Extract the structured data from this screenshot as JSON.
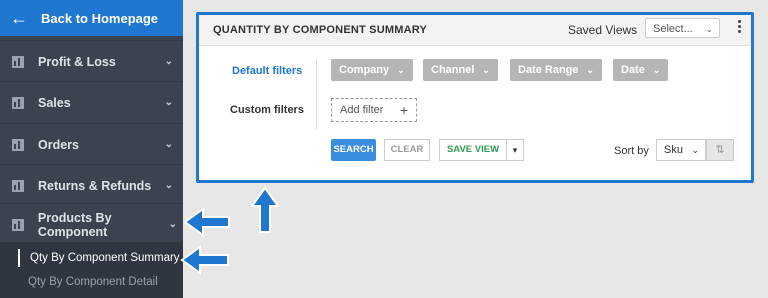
{
  "sidebar": {
    "back_label": "Back to Homepage",
    "items": [
      {
        "label": "Profit & Loss"
      },
      {
        "label": "Sales"
      },
      {
        "label": "Orders"
      },
      {
        "label": "Returns & Refunds"
      },
      {
        "label": "Products By Component"
      }
    ],
    "sub_items": [
      {
        "label": "Qty By Component Summary"
      },
      {
        "label": "Qty By Component Detail"
      }
    ]
  },
  "panel": {
    "title": "QUANTITY BY COMPONENT SUMMARY",
    "saved_views_label": "Saved Views",
    "saved_views_select": "Select...",
    "default_filters_label": "Default filters",
    "custom_filters_label": "Custom filters",
    "filters": [
      "Company",
      "Channel",
      "Date Range",
      "Date"
    ],
    "add_filter_label": "Add filter",
    "search_label": "SEARCH",
    "clear_label": "CLEAR",
    "save_view_label": "SAVE VIEW",
    "sort_by_label": "Sort by",
    "sort_value": "Sku"
  },
  "colors": {
    "accent": "#1f77d0",
    "sidebar": "#3b4350",
    "save": "#2f9e55"
  }
}
